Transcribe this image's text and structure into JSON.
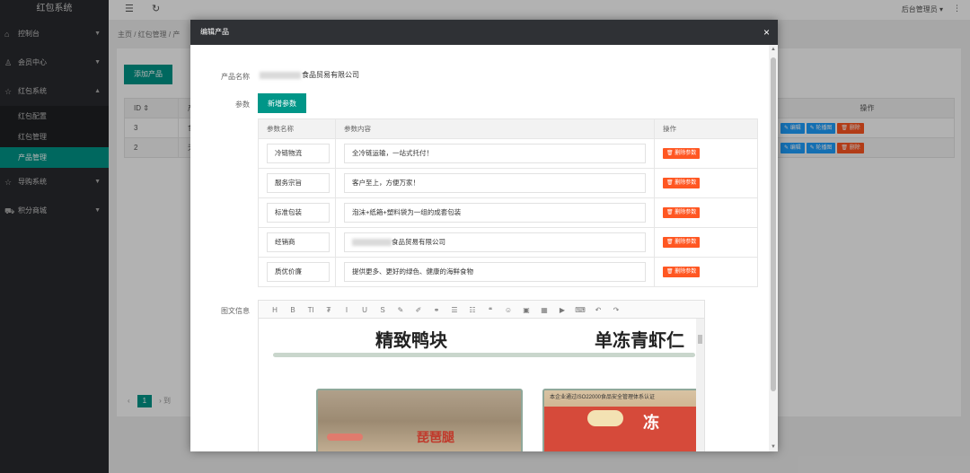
{
  "sidebar": {
    "title": "红包系统",
    "items": [
      {
        "label": "控制台",
        "icon": "home-icon"
      },
      {
        "label": "会员中心",
        "icon": "user-icon"
      },
      {
        "label": "红包系统",
        "icon": "star-icon"
      },
      {
        "label": "导购系统",
        "icon": "star-icon"
      },
      {
        "label": "积分商城",
        "icon": "cart-icon"
      }
    ],
    "subitems": [
      "红包配置",
      "红包管理",
      "产品管理"
    ]
  },
  "header": {
    "admin": "后台管理员 ▾",
    "more": "⋮"
  },
  "breadcrumb": "主页 / 红包管理 / 产",
  "panel": {
    "add_label": "添加产品",
    "columns": [
      "ID ⇕",
      "产",
      "操作"
    ],
    "rows": [
      {
        "id": "3",
        "c2": "食"
      },
      {
        "id": "2",
        "c2": "天"
      }
    ],
    "action_edit": "✎ 编辑",
    "action_carousel": "✎ 轮播图",
    "action_delete": "🗑 删除",
    "pager_page": "1",
    "pager_suffix": "到"
  },
  "modal": {
    "title": "编辑产品",
    "close": "×",
    "product_name_label": "产品名称",
    "product_name_value": "食品贸易有限公司",
    "params_label": "参数",
    "add_param_label": "新增参数",
    "param_headers": [
      "参数名称",
      "参数内容",
      "操作"
    ],
    "param_rows": [
      {
        "name": "冷链物流",
        "content": "全冷链运输，一站式托付！"
      },
      {
        "name": "服务宗旨",
        "content": "客户至上，方便万家！"
      },
      {
        "name": "标准包装",
        "content": "泡沫+纸箱+塑料袋为一组的成套包装"
      },
      {
        "name": "经销商",
        "content": "食品贸易有限公司",
        "blurred": true
      },
      {
        "name": "质优价廉",
        "content": "提供更多、更好的绿色、健康的海鲜食物"
      }
    ],
    "delete_param_label": "🗑 删除参数",
    "rich_text_label": "图文信息",
    "toolbar": [
      "H",
      "B",
      "Tl",
      "₮",
      "I",
      "U",
      "S",
      "✎",
      "✐",
      "⚭",
      "☰",
      "☷",
      "❝",
      "☺",
      "▣",
      "▦",
      "▶",
      "⌨",
      "↶",
      "↷"
    ],
    "content_heading_1": "精致鸭块",
    "content_heading_2": "单冻青虾仁",
    "photo1_text": "琵琶腿",
    "photo2_top": "本企业通过ISO22000食品安全管理体系认证",
    "photo2_big": "冻"
  }
}
